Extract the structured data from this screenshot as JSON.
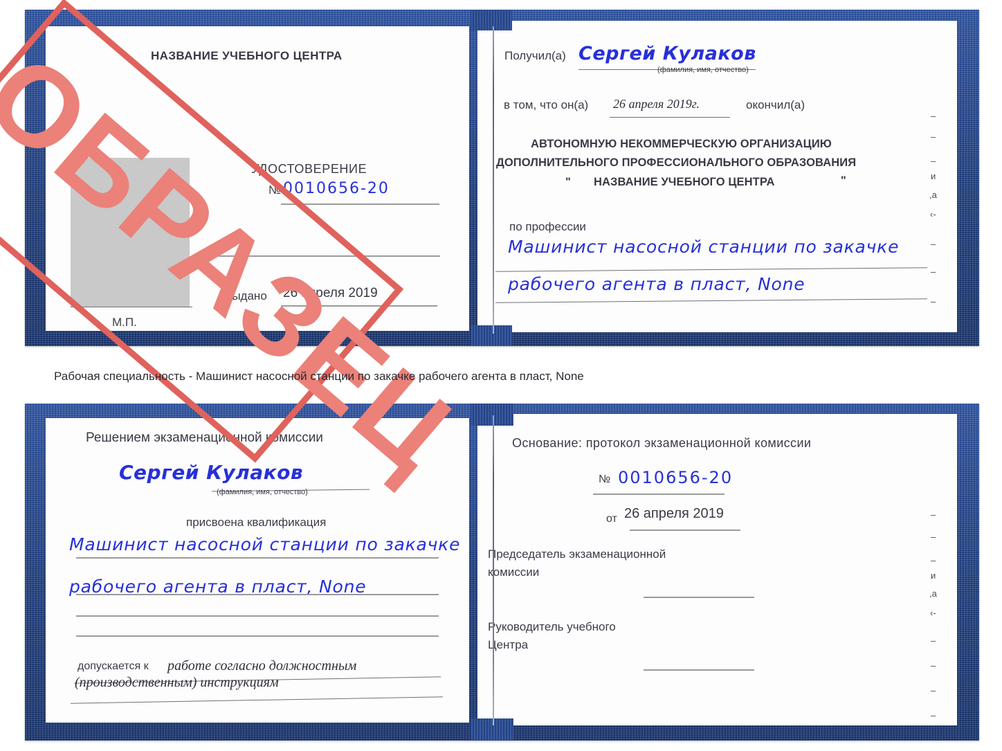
{
  "caption": {
    "text": "Рабочая специальность - Машинист насосной станции по закачке рабочего агента в пласт, None"
  },
  "stamp": {
    "label": "ОБРАЗЕЦ",
    "color": "#e0625c"
  },
  "colors": {
    "cover": "#27488f",
    "ink": "#2730d8",
    "print": "#3b3b46",
    "photo": "#c9c9c9"
  },
  "certificate_front": {
    "left_page": {
      "center_name": "НАЗВАНИЕ УЧЕБНОГО ЦЕНТРА",
      "doc_type": "УДОСТОВЕРЕНИЕ",
      "number_symbol": "№",
      "number": "0010656-20",
      "issued_label": "Выдано",
      "issued_date": "26 апреля 2019",
      "seal_mark": "М.П.",
      "photo_placeholder": "photo-placeholder"
    },
    "right_page": {
      "received_label": "Получил(а)",
      "received_name": "Сергей Кулаков",
      "name_hint": "(фамилия, имя, отчество)",
      "that_he_label": "в том, что он(а)",
      "completion_date": "26 апреля 2019г.",
      "finished_label": "окончил(а)",
      "org_line1": "АВТОНОМНУЮ НЕКОММЕРЧЕСКУЮ ОРГАНИЗАЦИЮ",
      "org_line2": "ДОПОЛНИТЕЛЬНОГО ПРОФЕССИОНАЛЬНОГО ОБРАЗОВАНИЯ",
      "org_quote_open": "\"",
      "org_line3": "НАЗВАНИЕ УЧЕБНОГО ЦЕНТРА",
      "org_quote_close": "\"",
      "profession_label": "по профессии",
      "profession_line1": "Машинист насосной станции по закачке",
      "profession_line2": "рабочего агента в пласт, None"
    }
  },
  "certificate_back": {
    "left_page": {
      "heading": "Решением экзаменационной комиссии",
      "name": "Сергей Кулаков",
      "name_hint": "(фамилия, имя, отчество)",
      "qualification_label": "присвоена квалификация",
      "qualification_line1": "Машинист насосной станции по закачке",
      "qualification_line2": "рабочего агента в пласт, None",
      "admitted_label": "допускается к",
      "admitted_line1": "работе согласно должностным",
      "admitted_line2": "(производственным) инструкциям"
    },
    "right_page": {
      "basis_label": "Основание: протокол экзаменационной комиссии",
      "number_symbol": "№",
      "number": "0010656-20",
      "from_label": "от",
      "from_date": "26 апреля 2019",
      "chairman_line1": "Председатель экзаменационной",
      "chairman_line2": "комиссии",
      "head_line1": "Руководитель учебного",
      "head_line2": "Центра"
    }
  },
  "edge_marks": {
    "front": [
      "–",
      "–",
      "–",
      "и",
      ",а",
      "‹-",
      "–",
      "–",
      "–"
    ],
    "back": [
      "–",
      "–",
      "–",
      "и",
      ",а",
      "‹-",
      "–",
      "–",
      "–",
      "–"
    ]
  }
}
